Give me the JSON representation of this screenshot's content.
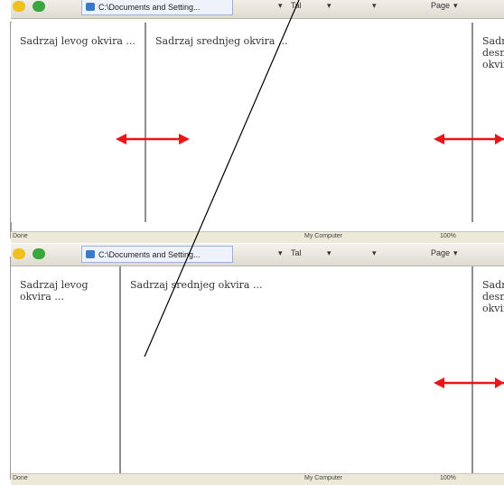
{
  "toolbar": {
    "tab_label": "C:\\Documents and Setting...",
    "items": [
      "Tal",
      "Page"
    ]
  },
  "frames": {
    "left": "Sadrzaj levog okvira ...",
    "middle": "Sadrzaj srednjeg okvira ...",
    "right": "Sadrzaj desnog okvira"
  },
  "status": {
    "top": [
      "Done",
      "My Computer",
      "100%"
    ],
    "bottom": [
      "Done",
      "My Computer",
      "100%"
    ]
  },
  "colors": {
    "arrow": "#e8151b",
    "divider": "#8e8e8e",
    "line": "#000000"
  }
}
